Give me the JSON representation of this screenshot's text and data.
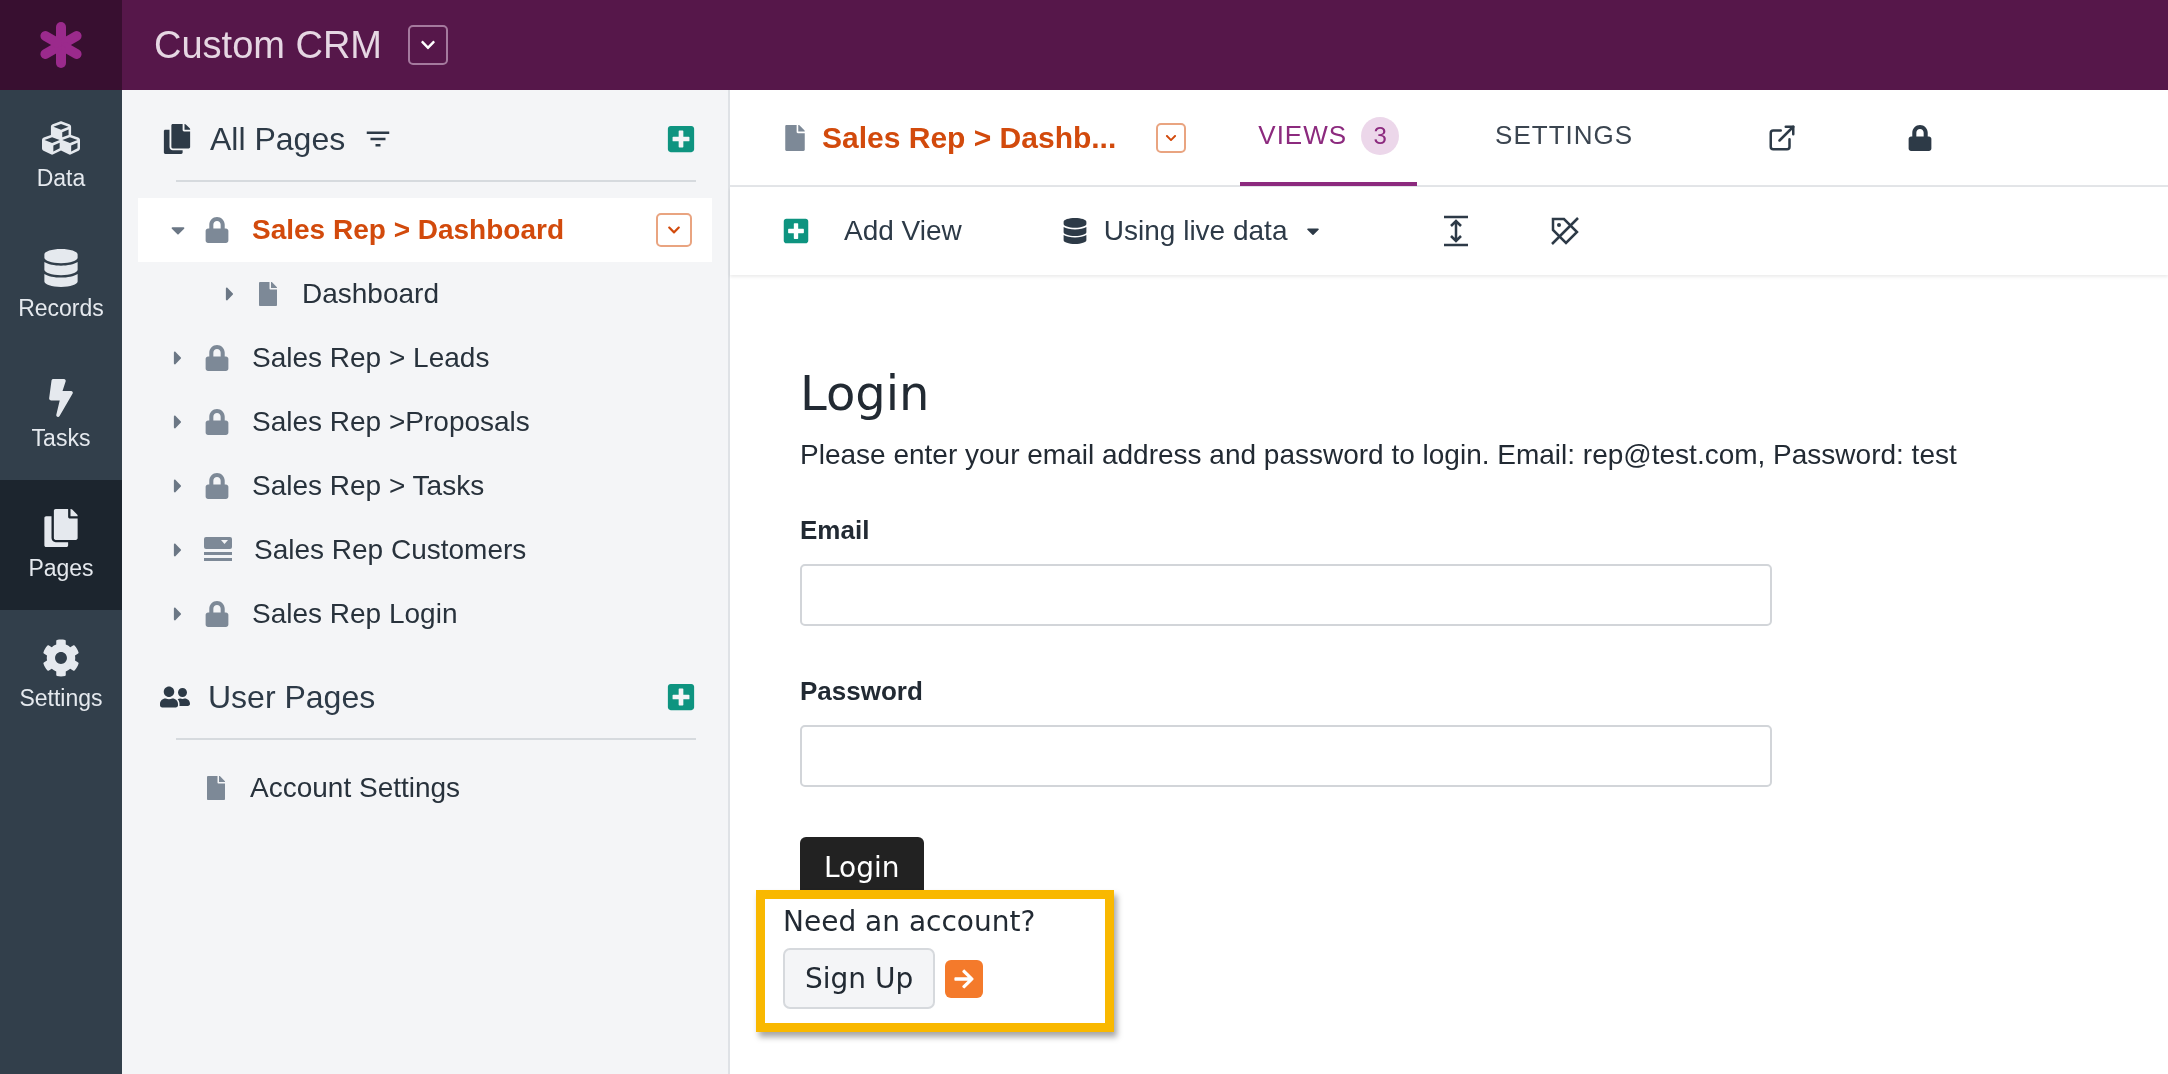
{
  "app": {
    "title": "Custom CRM"
  },
  "rail": [
    {
      "label": "Data",
      "kind": "cubes",
      "selected": false
    },
    {
      "label": "Records",
      "kind": "database",
      "selected": false
    },
    {
      "label": "Tasks",
      "kind": "bolt",
      "selected": false
    },
    {
      "label": "Pages",
      "kind": "pages",
      "selected": true
    },
    {
      "label": "Settings",
      "kind": "cog",
      "selected": false
    }
  ],
  "sidebar": {
    "all_pages": {
      "title": "All Pages",
      "pages": [
        {
          "label": "Sales Rep > Dashboard",
          "kind": "locked",
          "expanded": true,
          "selected": true,
          "children": [
            {
              "label": "Dashboard",
              "kind": "page",
              "expanded": false,
              "selected": false
            }
          ]
        },
        {
          "label": "Sales Rep > Leads",
          "kind": "locked",
          "expanded": false,
          "selected": false
        },
        {
          "label": "Sales Rep >Proposals",
          "kind": "locked",
          "expanded": false,
          "selected": false
        },
        {
          "label": "Sales Rep > Tasks",
          "kind": "locked",
          "expanded": false,
          "selected": false
        },
        {
          "label": "Sales Rep Customers",
          "kind": "table",
          "expanded": false,
          "selected": false
        },
        {
          "label": "Sales Rep Login",
          "kind": "locked",
          "expanded": false,
          "selected": false
        }
      ]
    },
    "user_pages": {
      "title": "User Pages",
      "pages": [
        {
          "label": "Account Settings",
          "kind": "page"
        }
      ]
    }
  },
  "header": {
    "page_title": "Sales Rep > Dashb...",
    "tabs": [
      {
        "label": "VIEWS",
        "badge": "3",
        "selected": true
      },
      {
        "label": "SETTINGS",
        "selected": false
      }
    ]
  },
  "toolbar": {
    "add_view": "Add View",
    "data_source": "Using live data"
  },
  "login": {
    "title": "Login",
    "instructions": "Please enter your email address and password to login. Email: rep@test.com, Password: test",
    "fields": [
      {
        "label": "Email"
      },
      {
        "label": "Password"
      }
    ],
    "submit": "Login",
    "signup_prompt": "Need an account?",
    "signup": "Sign Up"
  }
}
